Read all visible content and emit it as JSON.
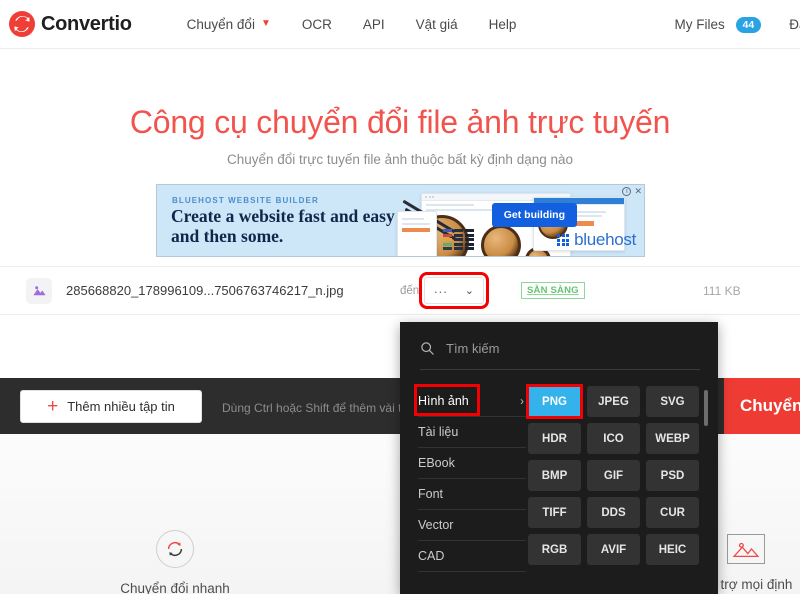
{
  "header": {
    "logo_text": "Convertio",
    "logo_icon": "convertio-logo-icon",
    "nav": [
      {
        "label": "Chuyển đổi",
        "has_caret": true
      },
      {
        "label": "OCR",
        "has_caret": false
      },
      {
        "label": "API",
        "has_caret": false
      },
      {
        "label": "Vật giá",
        "has_caret": false
      },
      {
        "label": "Help",
        "has_caret": false
      }
    ],
    "my_files_label": "My Files",
    "my_files_count": "44",
    "login_label": "Đăn",
    "badge_color": "#29a3e3",
    "accent_color": "#ef3e36"
  },
  "hero": {
    "title": "Công cụ chuyển đổi file ảnh trực tuyến",
    "subtitle": "Chuyển đổi trực tuyến file ảnh thuộc bất kỳ định dạng nào",
    "title_color": "#f2534d"
  },
  "ad": {
    "kicker": "BLUEHOST WEBSITE BUILDER",
    "headline": "Create a website fast and easy and then some.",
    "cta_label": "Get building",
    "brand": "bluehost",
    "info_icon": "ad-choices-info-icon",
    "close_icon": "ad-close-icon",
    "close_glyph": "✕",
    "info_glyph": "i"
  },
  "file_row": {
    "icon": "image-file-icon",
    "name": "285668820_178996109...7506763746217_n.jpg",
    "to_label": "đến",
    "format_button_value": "...",
    "chevron_glyph": "⌄",
    "status": "SẴN SÀNG",
    "status_color": "#62c473",
    "size": "111 KB"
  },
  "actions": {
    "add_files_label": "Thêm nhiều tập tin",
    "add_plus_glyph": "+",
    "hint": "Dùng Ctrl hoặc Shift để thêm vài tệp",
    "convert_label": "Chuyển đổi",
    "convert_color": "#ee3b33"
  },
  "dropdown": {
    "search_placeholder": "Tìm kiếm",
    "search_value": "",
    "search_icon": "search-icon",
    "categories": [
      {
        "label": "Hình ảnh",
        "selected": true,
        "arrow": "›"
      },
      {
        "label": "Tài liệu",
        "selected": false,
        "arrow": ""
      },
      {
        "label": "EBook",
        "selected": false,
        "arrow": ""
      },
      {
        "label": "Font",
        "selected": false,
        "arrow": ""
      },
      {
        "label": "Vector",
        "selected": false,
        "arrow": ""
      },
      {
        "label": "CAD",
        "selected": false,
        "arrow": ""
      }
    ],
    "formats": [
      {
        "label": "PNG",
        "selected": true
      },
      {
        "label": "JPEG",
        "selected": false
      },
      {
        "label": "SVG",
        "selected": false
      },
      {
        "label": "HDR",
        "selected": false
      },
      {
        "label": "ICO",
        "selected": false
      },
      {
        "label": "WEBP",
        "selected": false
      },
      {
        "label": "BMP",
        "selected": false
      },
      {
        "label": "GIF",
        "selected": false
      },
      {
        "label": "PSD",
        "selected": false
      },
      {
        "label": "TIFF",
        "selected": false
      },
      {
        "label": "DDS",
        "selected": false
      },
      {
        "label": "CUR",
        "selected": false
      },
      {
        "label": "RGB",
        "selected": false
      },
      {
        "label": "AVIF",
        "selected": false
      },
      {
        "label": "HEIC",
        "selected": false
      }
    ],
    "selected_color": "#33b2ec",
    "highlight_color": "#f40000"
  },
  "features": [
    {
      "label": "Chuyển đổi nhanh",
      "icon": "convert-circle-icon"
    },
    {
      "label": "Hỗ trợ mọi định",
      "icon": "image-formats-icon"
    }
  ]
}
